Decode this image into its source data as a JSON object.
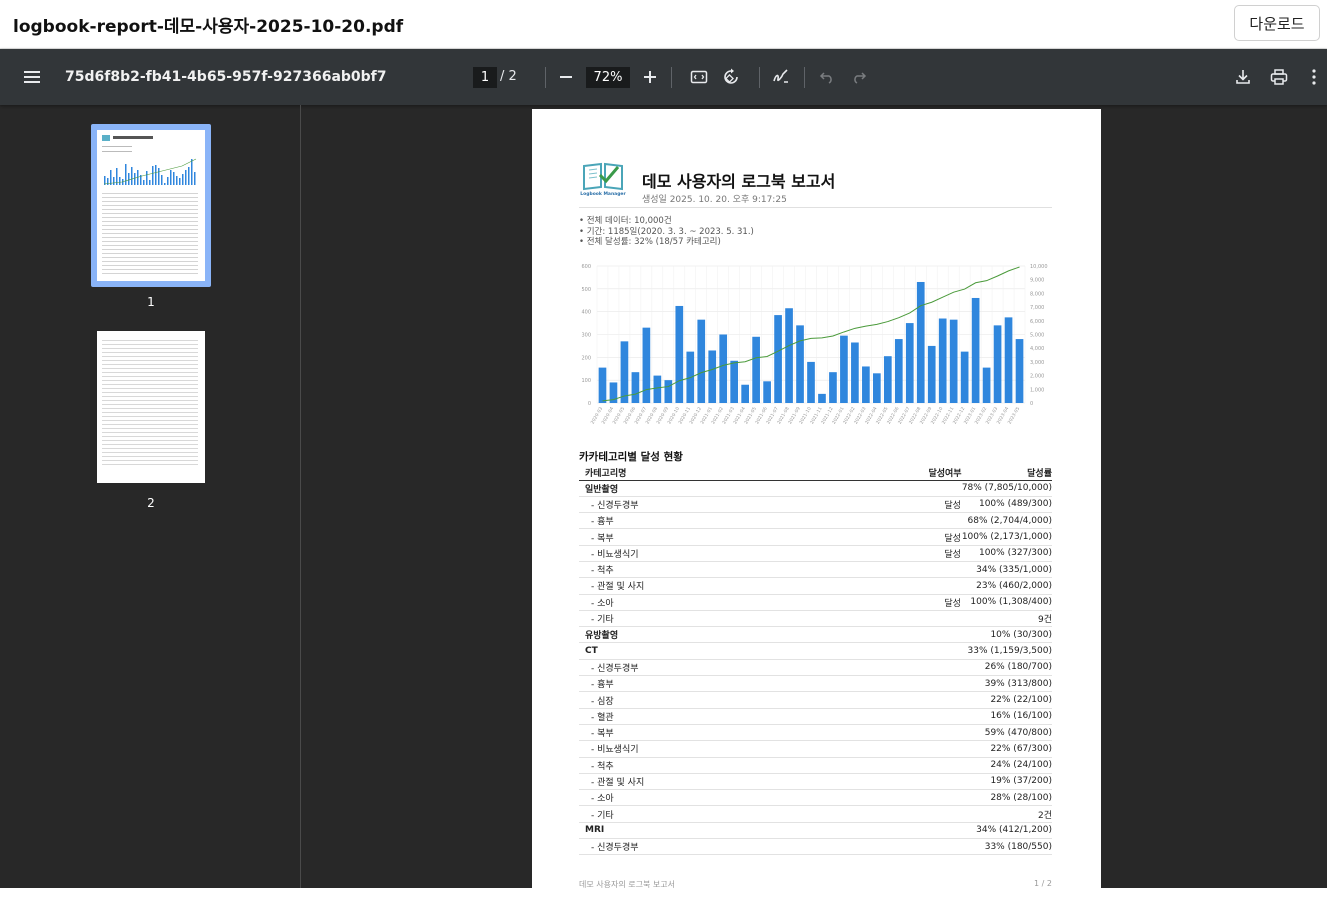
{
  "tab": {
    "filename": "logbook-report-데모-사용자-2025-10-20.pdf",
    "download_label": "다운로드"
  },
  "toolbar": {
    "doc_title": "75d6f8b2-fb41-4b65-957f-927366ab0bf7",
    "current_page": "1",
    "total_pages": "/  2",
    "zoom": "72%",
    "icons": [
      "menu-icon",
      "zoom-out-icon",
      "zoom-in-icon",
      "fit-page-icon",
      "rotate-icon",
      "annotate-icon",
      "undo-icon",
      "redo-icon",
      "download-icon",
      "print-icon",
      "more-icon"
    ]
  },
  "thumbnails": [
    {
      "label": "1"
    },
    {
      "label": "2"
    }
  ],
  "report": {
    "logo_text": "Logbook Manager",
    "title": "데모 사용자의 로그북 보고서",
    "generated": "생성일 2025. 10. 20. 오후 9:17:25",
    "summary": [
      "• 전체 데이터: 10,000건",
      "• 기간: 1185일(2020. 3. 3. ~ 2023. 5. 31.)",
      "• 전체 달성률: 32% (18/57 카테고리)"
    ],
    "section_title": "카카테고리별 달성 현황",
    "table": {
      "headers": [
        "카테고리명",
        "달성여부",
        "달성률"
      ],
      "rows": [
        {
          "name": "일반촬영",
          "status": "",
          "rate": "78% (7,805/10,000)",
          "group": true
        },
        {
          "name": "- 신경두경부",
          "status": "달성",
          "rate": "100% (489/300)",
          "group": false
        },
        {
          "name": "- 흉부",
          "status": "",
          "rate": "68% (2,704/4,000)",
          "group": false
        },
        {
          "name": "- 복부",
          "status": "달성",
          "rate": "100% (2,173/1,000)",
          "group": false
        },
        {
          "name": "- 비뇨생식기",
          "status": "달성",
          "rate": "100% (327/300)",
          "group": false
        },
        {
          "name": "- 척추",
          "status": "",
          "rate": "34% (335/1,000)",
          "group": false
        },
        {
          "name": "- 관절 및 사지",
          "status": "",
          "rate": "23% (460/2,000)",
          "group": false
        },
        {
          "name": "- 소아",
          "status": "달성",
          "rate": "100% (1,308/400)",
          "group": false
        },
        {
          "name": "- 기타",
          "status": "",
          "rate": "9건",
          "group": false
        },
        {
          "name": "유방촬영",
          "status": "",
          "rate": "10% (30/300)",
          "group": true
        },
        {
          "name": "CT",
          "status": "",
          "rate": "33% (1,159/3,500)",
          "group": true
        },
        {
          "name": "- 신경두경부",
          "status": "",
          "rate": "26% (180/700)",
          "group": false
        },
        {
          "name": "- 흉부",
          "status": "",
          "rate": "39% (313/800)",
          "group": false
        },
        {
          "name": "- 심장",
          "status": "",
          "rate": "22% (22/100)",
          "group": false
        },
        {
          "name": "- 혈관",
          "status": "",
          "rate": "16% (16/100)",
          "group": false
        },
        {
          "name": "- 복부",
          "status": "",
          "rate": "59% (470/800)",
          "group": false
        },
        {
          "name": "- 비뇨생식기",
          "status": "",
          "rate": "22% (67/300)",
          "group": false
        },
        {
          "name": "- 척추",
          "status": "",
          "rate": "24% (24/100)",
          "group": false
        },
        {
          "name": "- 관절 및 사지",
          "status": "",
          "rate": "19% (37/200)",
          "group": false
        },
        {
          "name": "- 소아",
          "status": "",
          "rate": "28% (28/100)",
          "group": false
        },
        {
          "name": "- 기타",
          "status": "",
          "rate": "2건",
          "group": false
        },
        {
          "name": "MRI",
          "status": "",
          "rate": "34% (412/1,200)",
          "group": true
        },
        {
          "name": "- 신경두경부",
          "status": "",
          "rate": "33% (180/550)",
          "group": false
        }
      ]
    },
    "footer_left": "데모 사용자의 로그북 보고서",
    "footer_right": "1 / 2"
  },
  "chart_data": {
    "type": "bar",
    "categories": [
      "2020-03",
      "2020-04",
      "2020-05",
      "2020-06",
      "2020-07",
      "2020-08",
      "2020-09",
      "2020-10",
      "2020-11",
      "2020-12",
      "2021-01",
      "2021-02",
      "2021-03",
      "2021-04",
      "2021-05",
      "2021-06",
      "2021-07",
      "2021-08",
      "2021-09",
      "2021-10",
      "2021-11",
      "2021-12",
      "2022-01",
      "2022-02",
      "2022-03",
      "2022-04",
      "2022-05",
      "2022-06",
      "2022-07",
      "2022-08",
      "2022-09",
      "2022-10",
      "2022-11",
      "2022-12",
      "2023-01",
      "2023-02",
      "2023-03",
      "2023-04",
      "2023-05"
    ],
    "series": [
      {
        "values": [
          155,
          90,
          270,
          135,
          330,
          120,
          100,
          425,
          225,
          365,
          230,
          300,
          185,
          80,
          290,
          95,
          385,
          415,
          340,
          180,
          40,
          135,
          295,
          265,
          160,
          130,
          205,
          280,
          350,
          530,
          250,
          370,
          365,
          225,
          460,
          155,
          340,
          375,
          280
        ],
        "color": "#2f86dd",
        "axis": "left"
      },
      {
        "values": [
          155,
          245,
          515,
          650,
          980,
          1100,
          1200,
          1625,
          1850,
          2215,
          2445,
          2745,
          2930,
          3010,
          3300,
          3395,
          3780,
          4195,
          4535,
          4715,
          4755,
          4890,
          5185,
          5450,
          5610,
          5740,
          5945,
          6225,
          6575,
          7105,
          7355,
          7725,
          8090,
          8315,
          8775,
          8930,
          9270,
          9645,
          9925
        ],
        "color": "#4a9a3a",
        "axis": "right"
      }
    ],
    "ylim_left": [
      0,
      600
    ],
    "ylim_right": [
      0,
      10000
    ],
    "yticks_left": [
      "0",
      "100",
      "200",
      "300",
      "400",
      "500",
      "600"
    ],
    "yticks_right": [
      "0",
      "1,000",
      "2,000",
      "3,000",
      "4,000",
      "5,000",
      "6,000",
      "7,000",
      "8,000",
      "9,000",
      "10,000"
    ],
    "grid": true
  }
}
